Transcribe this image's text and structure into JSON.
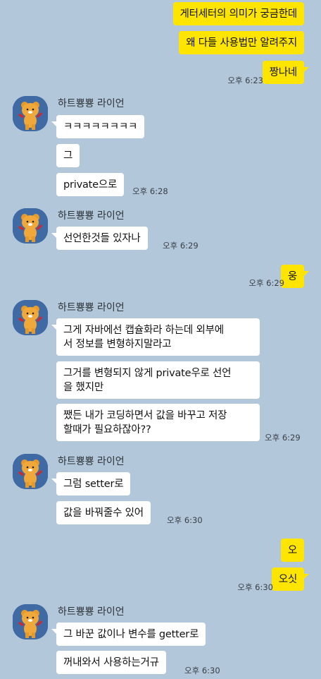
{
  "chat": {
    "sender_name": "하트뿅뿅 라이언",
    "messages": {
      "m1": "게터세터의 의미가 궁금한데",
      "m2": "왜 다들 사용법만 알려주지",
      "m3": "짱나네",
      "t1": "오후 6:23",
      "m4": "ㅋㅋㅋㅋㅋㅋㅋㅋ",
      "m5": "그",
      "m6": "private으로",
      "t2": "오후 6:28",
      "m7": "선언한것들 있자나",
      "t3": "오후 6:29",
      "m8": "웅",
      "t4": "오후 6:29",
      "m9": "그게 자바에선 캡슐화라 하는데 외부에\n서 정보를 변형하지말라고",
      "m10": "그거를 변형되지 않게 private우로 선언\n을 했지만",
      "m11": "쨌든 내가 코딩하면서 값을 바꾸고 저장\n할때가 필요하잖아??",
      "t5": "오후 6:29",
      "m12": "그럼 setter로",
      "m13": "값을 바꿔줄수 있어",
      "t6": "오후 6:30",
      "m14": "오",
      "m15": "오싯",
      "t7": "오후 6:30",
      "m16": "그 바꾼 값이나 변수를 getter로",
      "m17": "꺼내와서 사용하는거규",
      "t8": "오후 6:30"
    }
  },
  "colors": {
    "background": "#b2c7da",
    "my_bubble": "#fee500",
    "their_bubble": "#ffffff",
    "avatar_bg": "#3f6aa3"
  },
  "icons": {
    "avatar": "ryan-character-icon"
  }
}
